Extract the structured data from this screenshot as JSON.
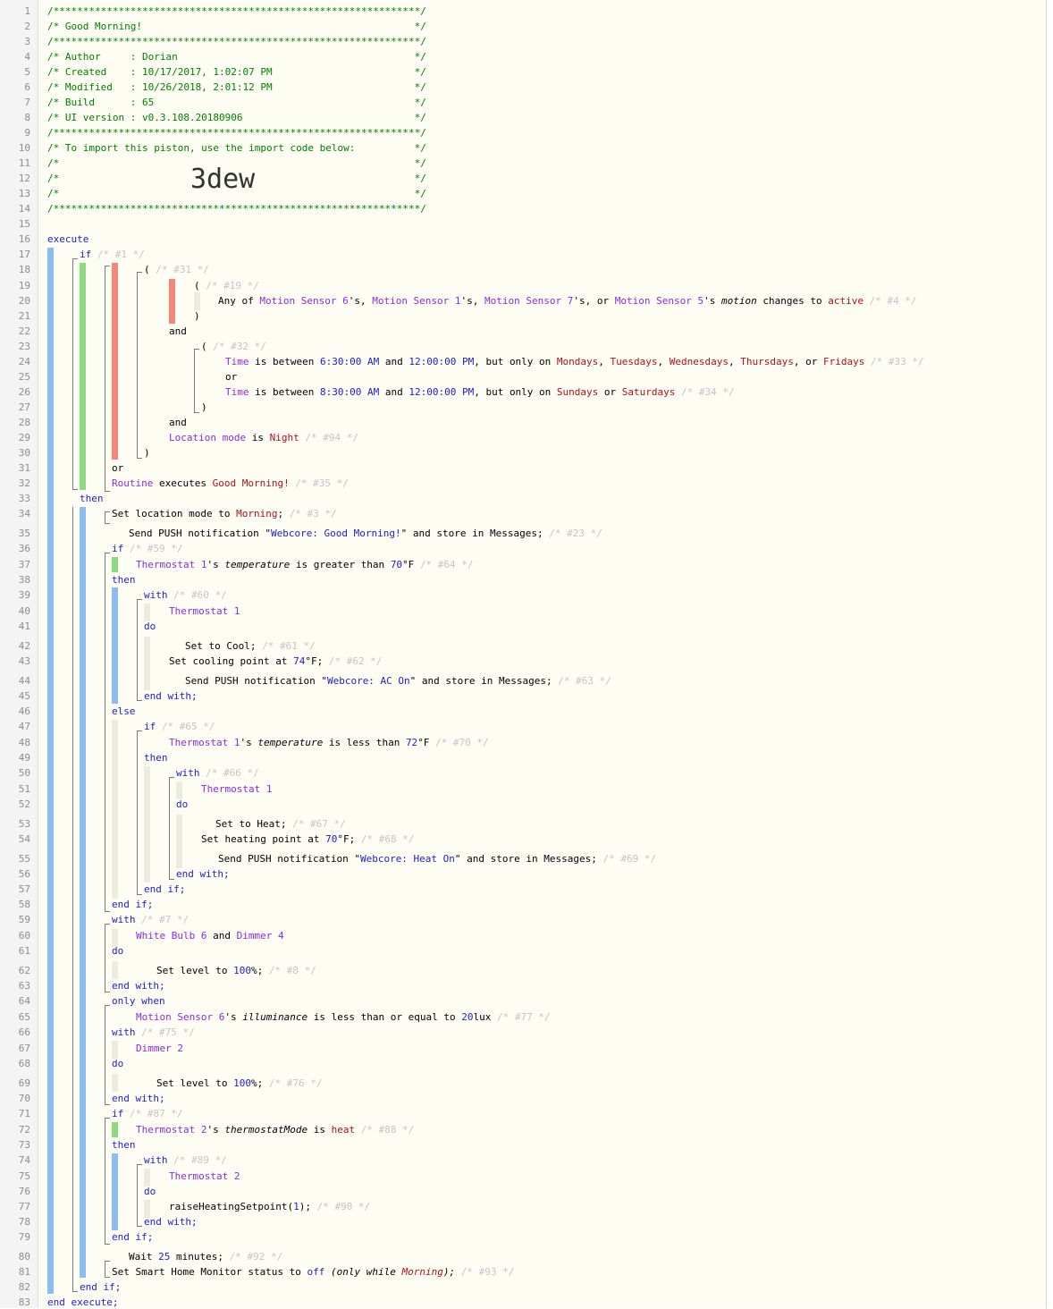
{
  "line_numbers": [
    "1",
    "2",
    "3",
    "4",
    "5",
    "6",
    "7",
    "8",
    "9",
    "10",
    "11",
    "12",
    "13",
    "14",
    "15",
    "16",
    "17",
    "18",
    "19",
    "20",
    "21",
    "22",
    "23",
    "24",
    "25",
    "26",
    "27",
    "28",
    "29",
    "30",
    "31",
    "32",
    "33",
    "34",
    "35",
    "36",
    "37",
    "38",
    "39",
    "40",
    "41",
    "42",
    "43",
    "44",
    "45",
    "46",
    "47",
    "48",
    "49",
    "50",
    "51",
    "52",
    "53",
    "54",
    "55",
    "56",
    "57",
    "58",
    "59",
    "60",
    "61",
    "62",
    "63",
    "64",
    "65",
    "66",
    "67",
    "68",
    "69",
    "70",
    "71",
    "72",
    "73",
    "74",
    "75",
    "76",
    "77",
    "78",
    "79",
    "80",
    "81",
    "82",
    "83"
  ],
  "header": {
    "border": "/**************************************************************/",
    "l2": "/* Good Morning!                                              */",
    "l4": "/* Author     : Dorian                                        */",
    "l5": "/* Created    : 10/17/2017, 1:02:07 PM                        */",
    "l6": "/* Modified   : 10/26/2018, 2:01:12 PM                        */",
    "l7": "/* Build      : 65                                            */",
    "l8": "/* UI version : v0.3.108.20180906                             */",
    "l10": "/* To import this piston, use the import code below:          */",
    "l11": "/*                                                            */",
    "import_code": "3dew"
  },
  "code": {
    "execute": "execute",
    "if": "if",
    "then": "then",
    "else": "else",
    "and": "and",
    "or": "or",
    "with": "with",
    "do": "do",
    "end_with": "end with;",
    "end_if": "end if;",
    "end_execute": "end execute;",
    "only_when": "only when",
    "paren_open": "(",
    "paren_close": ")",
    "c1": "/* #1 */",
    "c31": "/* #31 */",
    "c19": "/* #19 */",
    "c4": "/* #4 */",
    "c32": "/* #32 */",
    "c33": "/* #33 */",
    "c34": "/* #34 */",
    "c94": "/* #94 */",
    "c35": "/* #35 */",
    "c3": "/* #3 */",
    "c23": "/* #23 */",
    "c59": "/* #59 */",
    "c64": "/* #64 */",
    "c60": "/* #60 */",
    "c61": "/* #61 */",
    "c62": "/* #62 */",
    "c63": "/* #63 */",
    "c65": "/* #65 */",
    "c70": "/* #70 */",
    "c66": "/* #66 */",
    "c67": "/* #67 */",
    "c68": "/* #68 */",
    "c69": "/* #69 */",
    "c7": "/* #7 */",
    "c8": "/* #8 */",
    "c77": "/* #77 */",
    "c75": "/* #75 */",
    "c76": "/* #76 */",
    "c87": "/* #87 */",
    "c88": "/* #88 */",
    "c89": "/* #89 */",
    "c90": "/* #90 */",
    "c92": "/* #92 */",
    "c93": "/* #93 */",
    "any_of": "Any of ",
    "ms6": "Motion Sensor 6",
    "ms1": "Motion Sensor 1",
    "ms7": "Motion Sensor 7",
    "ms5": "Motion Sensor 5",
    "s_comma": "'s, ",
    "s_comma_or": "'s, or ",
    "s_sp": "'s ",
    "motion": "motion",
    "changes_to": " changes to ",
    "active": "active",
    "time": "Time",
    "is_between": " is between ",
    "t630": "6:30:00 AM",
    "and_sp": " and ",
    "t1200": "12:00:00 PM",
    "but_only_on": ", but only on ",
    "mondays": "Mondays",
    "tuesdays": "Tuesdays",
    "wednesdays": "Wednesdays",
    "thursdays": "Thursdays",
    "fridays": "Fridays",
    "comma_sp": ", ",
    "comma_or": ", or ",
    "t830": "8:30:00 AM",
    "sundays": "Sundays",
    "or_sp": " or ",
    "saturdays": "Saturdays",
    "location_mode": "Location mode",
    "is_sp": " is ",
    "night": "Night",
    "routine": "Routine",
    "executes": " executes ",
    "good_morning": "Good Morning!",
    "set_loc_mode": "Set location mode to ",
    "morning": "Morning",
    "semi": ";",
    "send_push": "Send PUSH notification \"",
    "msg_gm": "Webcore: Good Morning!",
    "store_in": "\" and store in Messages;",
    "thermostat1": "Thermostat 1",
    "thermostat2": "Thermostat 2",
    "temperature": "temperature",
    "greater_than": " is greater than ",
    "less_than": " is less than ",
    "v70": "70",
    "v72": "72",
    "v74": "74",
    "deg_f": "°F",
    "deg_f_semi": "°F;",
    "set_cool": "Set to Cool;",
    "set_cool_pt": "Set cooling point at ",
    "msg_ac": "Webcore: AC On",
    "set_heat": "Set to Heat;",
    "set_heat_pt": "Set heating point at ",
    "msg_heat": "Webcore: Heat On",
    "white_bulb6": "White Bulb 6",
    "dimmer4": "Dimmer 4",
    "dimmer2": "Dimmer 2",
    "set_level": "Set level to ",
    "v100": "100",
    "pct_semi": "%;",
    "illuminance": "illuminance",
    "lte": " is less than or equal to ",
    "v20": "20",
    "lux": "lux",
    "thermostat_mode": "thermostatMode",
    "heat": "heat",
    "raise": "raiseHeatingSetpoint(",
    "v1": "1",
    "raise_end": ");",
    "wait": "Wait ",
    "v25": "25",
    "minutes": " minutes;",
    "set_shm": "Set Smart Home Monitor status to ",
    "off": "off",
    "only_while": "(only while ",
    "only_while_end": ");"
  },
  "colors": {
    "comment": "#008000",
    "keyword": "#1c1cd0",
    "device": "#8a2be2",
    "value": "#b0101a",
    "blue_bar": "#8bbdf0",
    "green_bar": "#8fd97f",
    "red_bar": "#f4877a"
  }
}
